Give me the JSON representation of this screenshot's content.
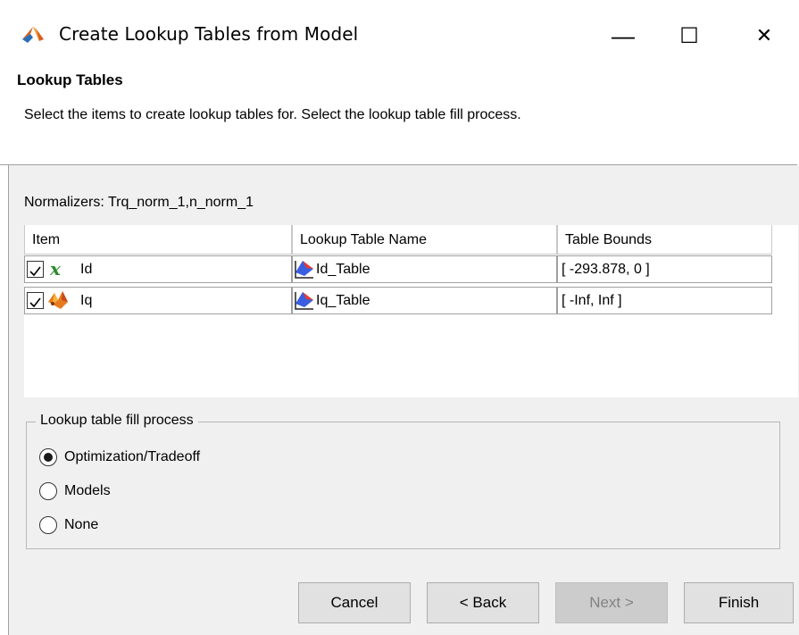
{
  "window": {
    "title": "Create Lookup Tables from Model",
    "controls": {
      "minimize": "—",
      "maximize": "☐",
      "close": "✕"
    }
  },
  "header": {
    "title": "Lookup Tables",
    "description": "Select the items to create lookup tables for. Select the lookup table fill process."
  },
  "normalizers": "Normalizers: Trq_norm_1,n_norm_1",
  "table": {
    "columns": [
      "Item",
      "Lookup Table Name",
      "Table Bounds"
    ],
    "rows": [
      {
        "checked": true,
        "item_icon": "variable-x-icon",
        "item": "Id",
        "table_icon": "lookup-table-icon",
        "table_name": "Id_Table",
        "bounds": "[ -293.878, 0 ]"
      },
      {
        "checked": true,
        "item_icon": "model-icon",
        "item": "Iq",
        "table_icon": "lookup-table-icon",
        "table_name": "Iq_Table",
        "bounds": "[ -Inf, Inf ]"
      }
    ]
  },
  "fill_process": {
    "legend": "Lookup table fill process",
    "options": [
      "Optimization/Tradeoff",
      "Models",
      "None"
    ],
    "selected": "Optimization/Tradeoff"
  },
  "buttons": {
    "cancel": "Cancel",
    "back": "< Back",
    "next": "Next >",
    "finish": "Finish"
  },
  "colors": {
    "panel_bg": "#f0f0f0",
    "accent_green": "#2e8b2e",
    "disabled_text": "#838383"
  }
}
